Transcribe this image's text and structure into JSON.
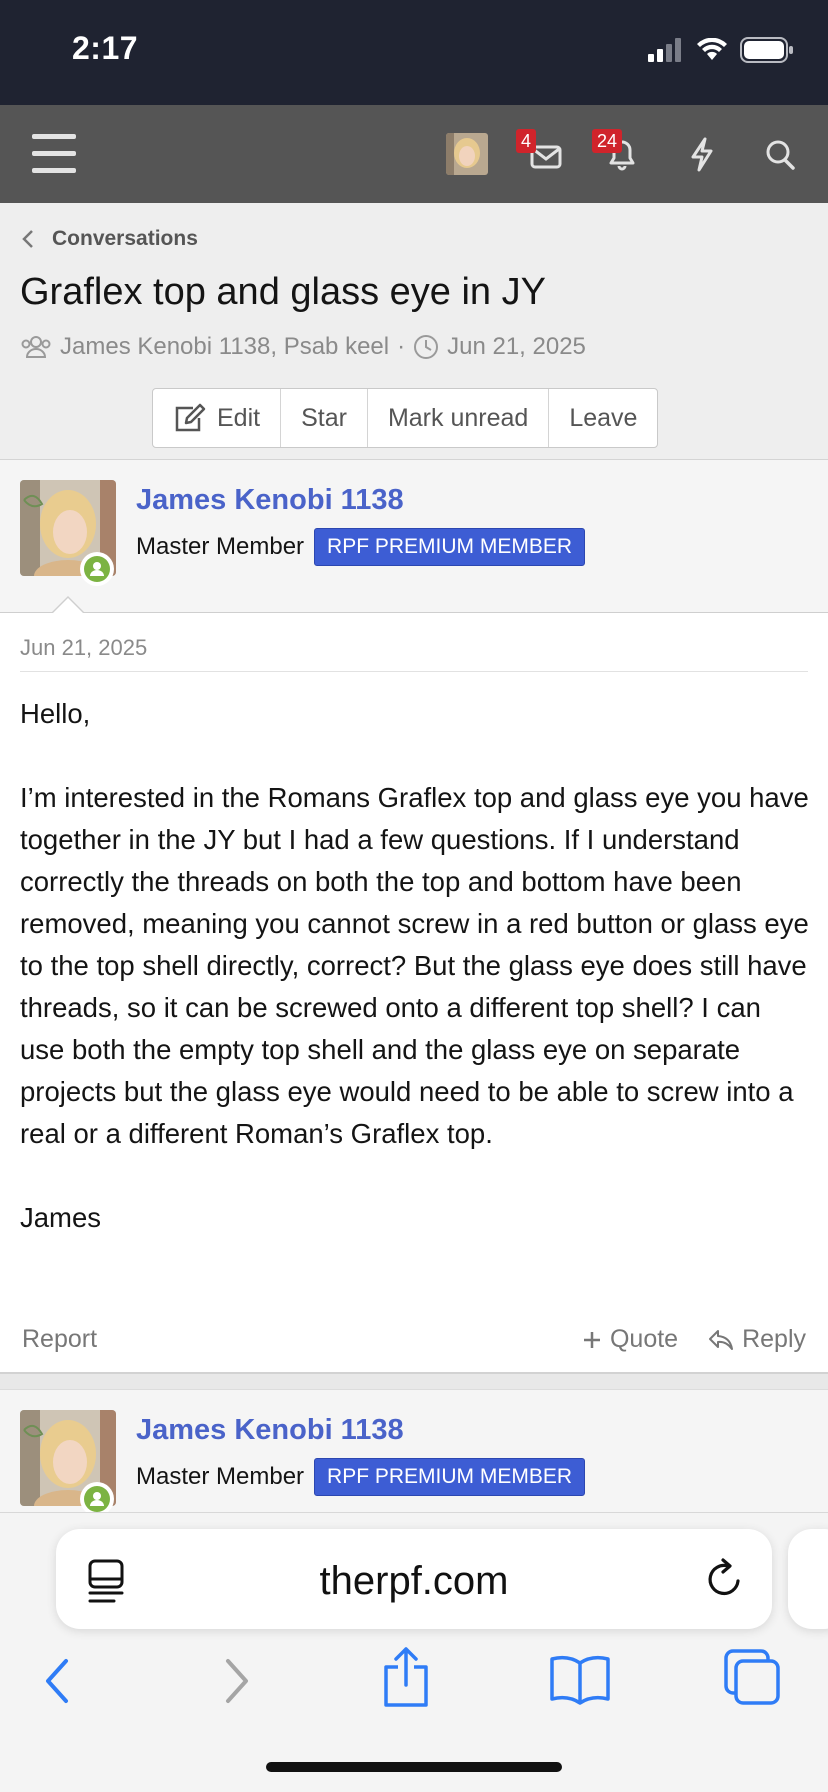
{
  "status_bar": {
    "time": "2:17"
  },
  "navbar": {
    "inbox_count": "4",
    "alerts_count": "24"
  },
  "header": {
    "breadcrumb": "Conversations",
    "title": "Graflex top and glass eye in JY",
    "participants": "James Kenobi 1138, Psab keel",
    "separator": "·",
    "date": "Jun 21, 2025",
    "buttons": {
      "edit": "Edit",
      "star": "Star",
      "mark_unread": "Mark unread",
      "leave": "Leave"
    }
  },
  "message": {
    "username": "James Kenobi 1138",
    "user_title": "Master Member",
    "user_banner": "RPF PREMIUM MEMBER",
    "date": "Jun 21, 2025",
    "greeting": "Hello,",
    "body": "I’m interested in the Romans Graflex top and glass eye you have together in the JY but I had a few questions. If I understand correctly the threads on both the top and bottom have been removed, meaning you cannot screw in a red button or glass eye to the top shell directly, correct? But the glass eye does still have threads, so it can be screwed onto a different top shell? I can use both the empty top shell and the glass eye on separate projects but the glass eye would need to be able to screw into a real or a different Roman’s Graflex top.",
    "signoff": "James",
    "actions": {
      "report": "Report",
      "quote": "Quote",
      "reply": "Reply"
    }
  },
  "message2": {
    "username": "James Kenobi 1138",
    "user_title": "Master Member",
    "user_banner": "RPF PREMIUM MEMBER"
  },
  "browser": {
    "url": "therpf.com"
  },
  "colors": {
    "navbar": "#555555",
    "status_bar": "#1f2331",
    "username": "#4a63c9",
    "banner": "#3d5dd4",
    "badge": "#d0242b",
    "online": "#7cb342",
    "ios_blue": "#2f7cf6"
  },
  "icons": [
    "hamburger-menu-icon",
    "inbox-icon",
    "bell-icon",
    "bolt-icon",
    "search-icon",
    "chevron-left-icon",
    "users-icon",
    "clock-icon",
    "edit-icon",
    "plus-icon",
    "reply-icon",
    "tabs-icon",
    "reload-icon",
    "back-icon",
    "forward-icon",
    "share-icon",
    "bookmarks-icon",
    "tab-overview-icon"
  ]
}
